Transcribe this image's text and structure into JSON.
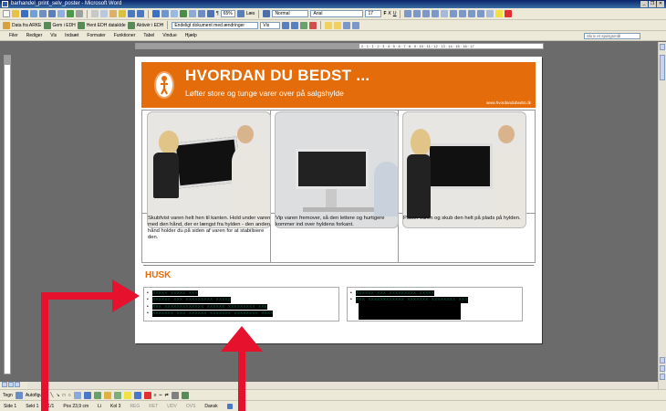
{
  "window": {
    "title": "barhandel_print_selv_poster - Microsoft Word"
  },
  "toolbar_standard": {
    "zoom": "65%",
    "read_label": "Læs",
    "style": "Normal",
    "font": "Arial",
    "font_size": "17"
  },
  "toolbar_review": {
    "item1": "Data fra ARKE",
    "item2": "Gem i EDH",
    "item3": "Hent EDH dataklde",
    "item4": "Aktivér i EDH",
    "track_display": "Endeligt dokument med ændringer",
    "show_label": "Vis"
  },
  "menu": {
    "items": [
      "Filer",
      "Rediger",
      "Vis",
      "Indsæt",
      "Formater",
      "Funktioner",
      "Tabel",
      "Vindue",
      "Hjælp"
    ],
    "help_placeholder": "Skriv et spørgsmål"
  },
  "ruler": {
    "text": "2 · 1 · 1 · 2 · 3 · 4 · 5 · 6 · 7 · 8 · 9 · 10 · 11 · 12 · 13 · 14 · 15 · 16 · 17"
  },
  "poster": {
    "title": "HVORDAN DU BEDST ...",
    "subtitle": "Løfter store og tunge varer over på salgshylde",
    "url": "www.hvordandubedst.dk",
    "captions": [
      "Skubfvist varen helt hen til kanten. Hold under varen med den hånd, der er længst fra hylden - den anden hånd holder du på siden af varen for at stabilisere den.",
      "Vip varen fremover, så den lettere og hurtigere kommer ind over hyldens forkant.",
      "Placer varen og skub den helt på plads på hylden."
    ],
    "husk_heading": "HUSK",
    "husk_left": [
      "Xxxxx xxxxx xxx",
      "Xxxxxx xxx xxxxxxxxx xxxxx",
      "Xxx xxxxxxxxxxxxx xxxxxx xxxxxxxxx xxx",
      "Xxxxxxx xxx xxxxxx xxxxxxx xxxxxxxx xxxx"
    ],
    "husk_right": [
      "Xxxxxx xxx xxxxxxxxx xxxxx",
      "Xxx xxxxxxxxxxxx xxxxxxx xxxxxxxx xxx"
    ]
  },
  "drawbar": {
    "tegn_label": "Tegn",
    "autoshapes_label": "Autofigurer"
  },
  "statusbar": {
    "page": "Side 1",
    "section": "Sekt 1",
    "pages": "1/1",
    "position": "Pos 23,9 cm",
    "line": "Li",
    "column": "Kol 3",
    "rec": "REG",
    "trk": "RET",
    "ext": "UDV",
    "ovr": "OVS",
    "language": "Dansk"
  },
  "colors": {
    "accent": "#e46c0a",
    "arrow": "#e5112d",
    "husk_text": "#0b5a42"
  }
}
